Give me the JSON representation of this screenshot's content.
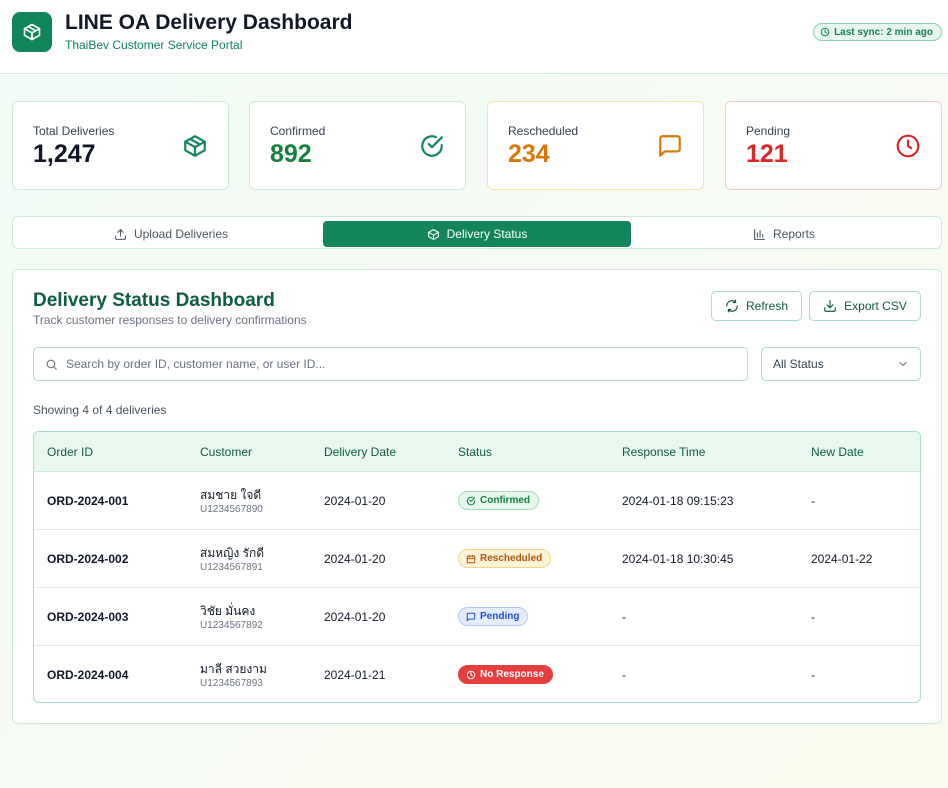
{
  "header": {
    "title": "LINE OA Delivery Dashboard",
    "subtitle": "ThaiBev Customer Service Portal",
    "sync": "Last sync: 2 min ago"
  },
  "stats": [
    {
      "label": "Total Deliveries",
      "value": "1,247",
      "color": "#111827",
      "icon": "box-icon"
    },
    {
      "label": "Confirmed",
      "value": "892",
      "color": "#15803d",
      "icon": "check-circle-icon"
    },
    {
      "label": "Rescheduled",
      "value": "234",
      "color": "#d97706",
      "icon": "message-icon"
    },
    {
      "label": "Pending",
      "value": "121",
      "color": "#dc2626",
      "icon": "clock-icon"
    }
  ],
  "tabs": [
    {
      "label": "Upload Deliveries",
      "icon": "upload-icon",
      "active": false
    },
    {
      "label": "Delivery Status",
      "icon": "box-icon",
      "active": true
    },
    {
      "label": "Reports",
      "icon": "bar-chart-icon",
      "active": false
    }
  ],
  "panel": {
    "title": "Delivery Status Dashboard",
    "subtitle": "Track customer responses to delivery confirmations",
    "refresh_label": "Refresh",
    "export_label": "Export CSV",
    "search_placeholder": "Search by order ID, customer name, or user ID...",
    "search_value": "",
    "status_filter": "All Status",
    "showing": "Showing 4 of 4 deliveries"
  },
  "table": {
    "columns": [
      "Order ID",
      "Customer",
      "Delivery Date",
      "Status",
      "Response Time",
      "New Date"
    ],
    "rows": [
      {
        "order_id": "ORD-2024-001",
        "customer": "สมชาย ใจดี",
        "user_id": "U1234567890",
        "delivery_date": "2024-01-20",
        "status": "Confirmed",
        "response_time": "2024-01-18 09:15:23",
        "new_date": "-"
      },
      {
        "order_id": "ORD-2024-002",
        "customer": "สมหญิง รักดี",
        "user_id": "U1234567891",
        "delivery_date": "2024-01-20",
        "status": "Rescheduled",
        "response_time": "2024-01-18 10:30:45",
        "new_date": "2024-01-22"
      },
      {
        "order_id": "ORD-2024-003",
        "customer": "วิชัย มั่นคง",
        "user_id": "U1234567892",
        "delivery_date": "2024-01-20",
        "status": "Pending",
        "response_time": "-",
        "new_date": "-"
      },
      {
        "order_id": "ORD-2024-004",
        "customer": "มาลี สวยงาม",
        "user_id": "U1234567893",
        "delivery_date": "2024-01-21",
        "status": "No Response",
        "response_time": "-",
        "new_date": "-"
      }
    ]
  },
  "colors": {
    "brand": "#12855b",
    "confirmed": "#15803d",
    "rescheduled": "#d97706",
    "pending": "#1d4ed8",
    "no_response": "#e53e3e"
  }
}
